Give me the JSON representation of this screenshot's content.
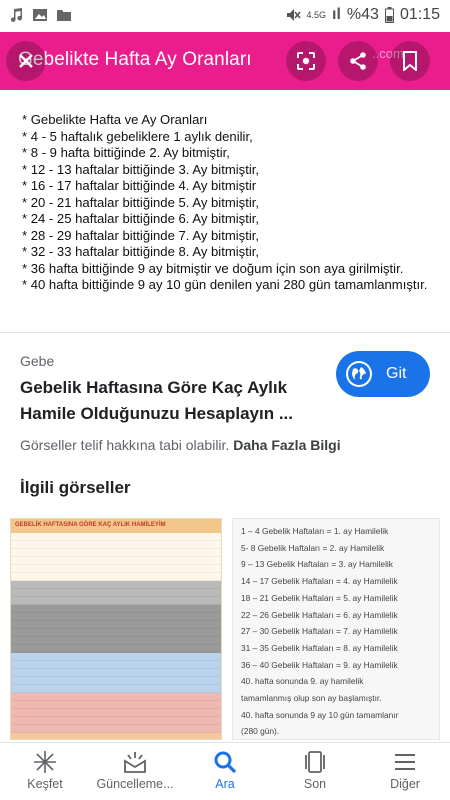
{
  "status_bar": {
    "network": "4.5G",
    "signal_bars": "ıl",
    "battery": "%43",
    "time": "01:15"
  },
  "header": {
    "title": "Gebelikte Hafta Ay Oranları",
    "watermark": "..com",
    "color": "#e91e8c"
  },
  "image_text": {
    "lines": [
      "* Gebelikte Hafta ve Ay Oranları",
      "* 4 - 5 haftalık gebeliklere 1 aylık denilir,",
      "* 8 - 9 hafta bittiğinde 2. Ay bitmiştir,",
      "* 12 - 13 haftalar bittiğinde 3. Ay bitmiştir,",
      "* 16 - 17 haftalar bittiğinde 4. Ay bitmiştir",
      "* 20 - 21 haftalar bittiğinde 5. Ay bitmiştir,",
      "* 24 - 25 haftalar bittiğinde 6. Ay bitmiştir,",
      "* 28 - 29 haftalar bittiğinde 7. Ay bitmiştir,",
      "* 32 - 33 haftalar bittiğinde 8. Ay bitmiştir,",
      "* 36 hafta bittiğinde 9 ay bitmiştir ve doğum için son aya girilmiştir.",
      "* 40 hafta bittiğinde 9 ay 10 gün denilen yani 280 gün tamamlanmıştır."
    ]
  },
  "result": {
    "source": "Gebe",
    "title": "Gebelik Haftasına Göre Kaç Aylık Hamile Olduğunuzu Hesaplayın ...",
    "go_label": "Git",
    "copyright_text": "Görseller telif hakkına tabi olabilir.",
    "more_info": "Daha Fazla Bilgi",
    "related_heading": "İlgili görseller"
  },
  "thumbnails": {
    "left": {
      "header": "GEBELİK HAFTASINA GÖRE KAÇ AYLIK HAMİLEYİM",
      "row_colors": [
        "#fdf6e9",
        "#fdf6e9",
        "#fdf6e9",
        "#fdf6e9",
        "#fdf6e9",
        "#fdf6e9",
        "#fdf6e9",
        "#fdf6e9",
        "#fdf6e9",
        "#fdf6e9",
        "#fdf6e9",
        "#fdf6e9",
        "#fdf6e9",
        "#fdf6e9",
        "#fdf6e9",
        "#fdf6e9",
        "#fdf6e9",
        "#fdf6e9",
        "#fdf6e9",
        "#fdf6e9"
      ]
    },
    "right": {
      "lines": [
        "1 – 4 Gebelik Haftaları =  1. ay Hamilelik",
        "5- 8 Gebelik Haftaları =  2. ay Hamilelik",
        "9 – 13 Gebelik Haftaları =  3. ay Hamilelik",
        "14 – 17 Gebelik Haftaları = 4. ay Hamilelik",
        "18 – 21 Gebelik Haftaları = 5. ay Hamilelik",
        "22 – 26 Gebelik Haftaları = 6. ay Hamilelik",
        "27 – 30 Gebelik Haftaları = 7. ay Hamilelik",
        "31 – 35 Gebelik Haftaları = 8. ay Hamilelik",
        "36 – 40 Gebelik Haftaları = 9. ay Hamilelik",
        "40. hafta sonunda 9. ay hamilelik",
        "tamamlanmış olup son ay başlamıştır.",
        "40. hafta sonunda 9 ay 10 gün tamamlanır",
        "(280 gün)."
      ]
    }
  },
  "bottom_nav": {
    "items": [
      {
        "label": "Keşfet",
        "icon": "asterisk-icon"
      },
      {
        "label": "Güncelleme...",
        "icon": "updates-icon"
      },
      {
        "label": "Ara",
        "icon": "search-icon"
      },
      {
        "label": "Son",
        "icon": "recent-icon"
      },
      {
        "label": "Diğer",
        "icon": "menu-icon"
      }
    ],
    "active_index": 2,
    "active_color": "#1a73e8"
  }
}
